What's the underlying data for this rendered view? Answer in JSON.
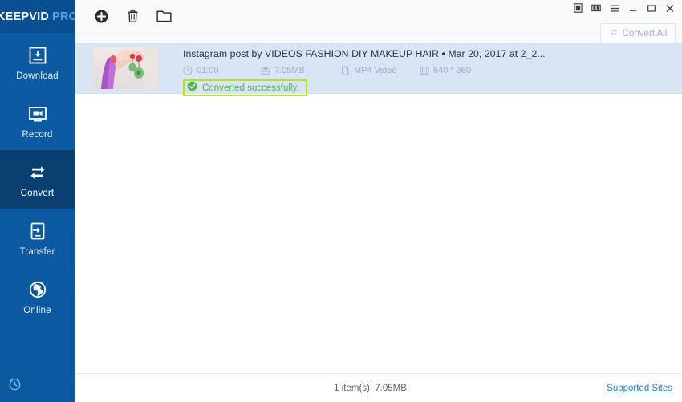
{
  "app": {
    "logo_main": "KEEPVID",
    "logo_sub": "PRO"
  },
  "sidebar": {
    "items": [
      {
        "label": "Download",
        "icon": "download-box-icon",
        "active": false
      },
      {
        "label": "Record",
        "icon": "monitor-record-icon",
        "active": false
      },
      {
        "label": "Convert",
        "icon": "convert-arrows-icon",
        "active": true
      },
      {
        "label": "Transfer",
        "icon": "transfer-device-icon",
        "active": false
      },
      {
        "label": "Online",
        "icon": "globe-icon",
        "active": false
      }
    ],
    "bottom": {
      "icon": "alarm-clock-icon",
      "label": "Scheduler"
    }
  },
  "toolbar": {
    "buttons": [
      {
        "name": "add-file-button",
        "icon": "plus-circle-icon",
        "label": "Add"
      },
      {
        "name": "delete-button",
        "icon": "trash-icon",
        "label": "Delete"
      },
      {
        "name": "open-folder-button",
        "icon": "folder-icon",
        "label": "Open folder"
      }
    ]
  },
  "window_controls": [
    {
      "name": "notes-icon",
      "glyph": "notes"
    },
    {
      "name": "feedback-icon",
      "glyph": "feedback"
    },
    {
      "name": "menu-icon",
      "glyph": "menu"
    },
    {
      "name": "minimize-icon",
      "glyph": "minimize"
    },
    {
      "name": "maximize-icon",
      "glyph": "maximize"
    },
    {
      "name": "close-icon",
      "glyph": "close"
    }
  ],
  "convert_all": {
    "label": "Convert All",
    "icon": "convert-arrows-icon",
    "enabled": false
  },
  "list": {
    "rows": [
      {
        "title": "Instagram post by VIDEOS FASHION DIY MAKEUP HAIR • Mar 20, 2017 at 2_2...",
        "duration": "01:00",
        "size": "7.05MB",
        "format": "MP4 Video",
        "resolution": "640 * 360",
        "status": "Converted successfully.",
        "status_color": "#4db848",
        "highlight_color": "#b5e61d",
        "selected": true
      }
    ]
  },
  "statusbar": {
    "count_text": "1 item(s), 7.05MB",
    "link_text": "Supported Sites"
  },
  "colors": {
    "sidebar_bg": "#0b5aa1",
    "sidebar_active": "#0a3f72",
    "logo_accent": "#4da3e8",
    "row_selected": "#d8e5f4",
    "link": "#2a7fd4"
  }
}
